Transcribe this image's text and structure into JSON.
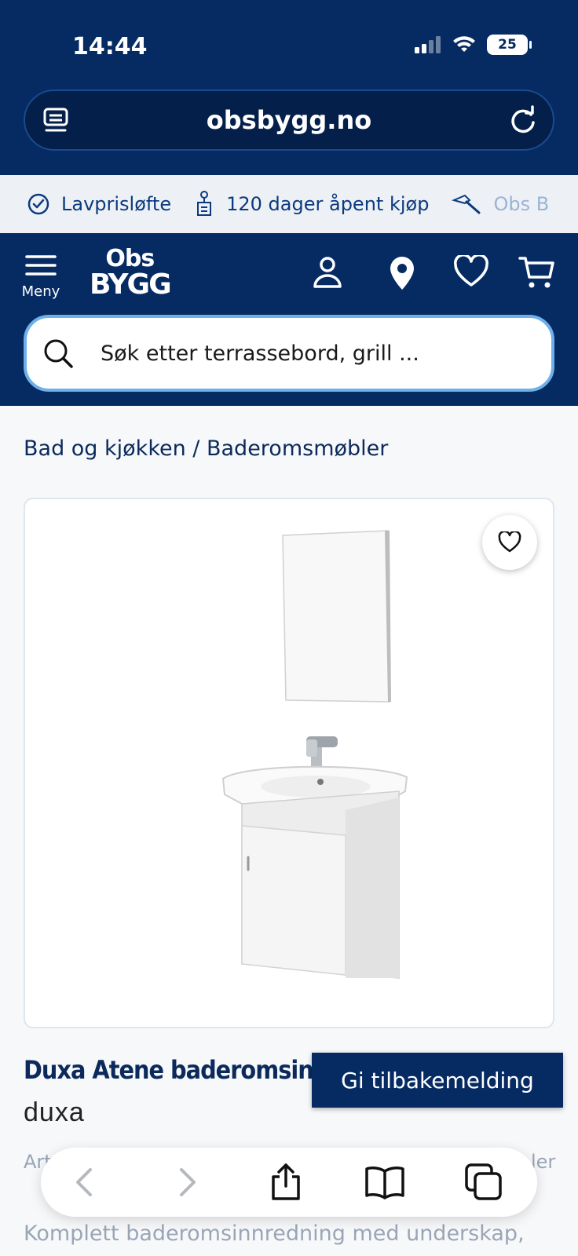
{
  "status_bar": {
    "time": "14:44",
    "battery": "25"
  },
  "browser": {
    "url": "obsbygg.no"
  },
  "usp_bar": {
    "items": [
      {
        "label": "Lavprisløfte",
        "icon": "check-circle-icon"
      },
      {
        "label": "120 dager åpent kjøp",
        "icon": "return-tag-icon"
      },
      {
        "label": "Obs B",
        "icon": "hammer-icon"
      }
    ]
  },
  "header": {
    "menu_label": "Meny",
    "logo_line1": "Obs",
    "logo_line2": "BYGG",
    "search_placeholder": "Søk etter terrassebord, grill ..."
  },
  "breadcrumb": "Bad og kjøkken / Baderomsmøbler",
  "product": {
    "title": "Duxa Atene baderomsinnred",
    "brand": "duxa",
    "article_prefix": "Art",
    "article_suffix": "ler",
    "description": "Komplett baderomsinnredning med underskap,"
  },
  "feedback_button": "Gi tilbakemelding",
  "colors": {
    "navy": "#062b63",
    "accent_blue": "#6fb0ea",
    "background": "#f7f8fa"
  }
}
